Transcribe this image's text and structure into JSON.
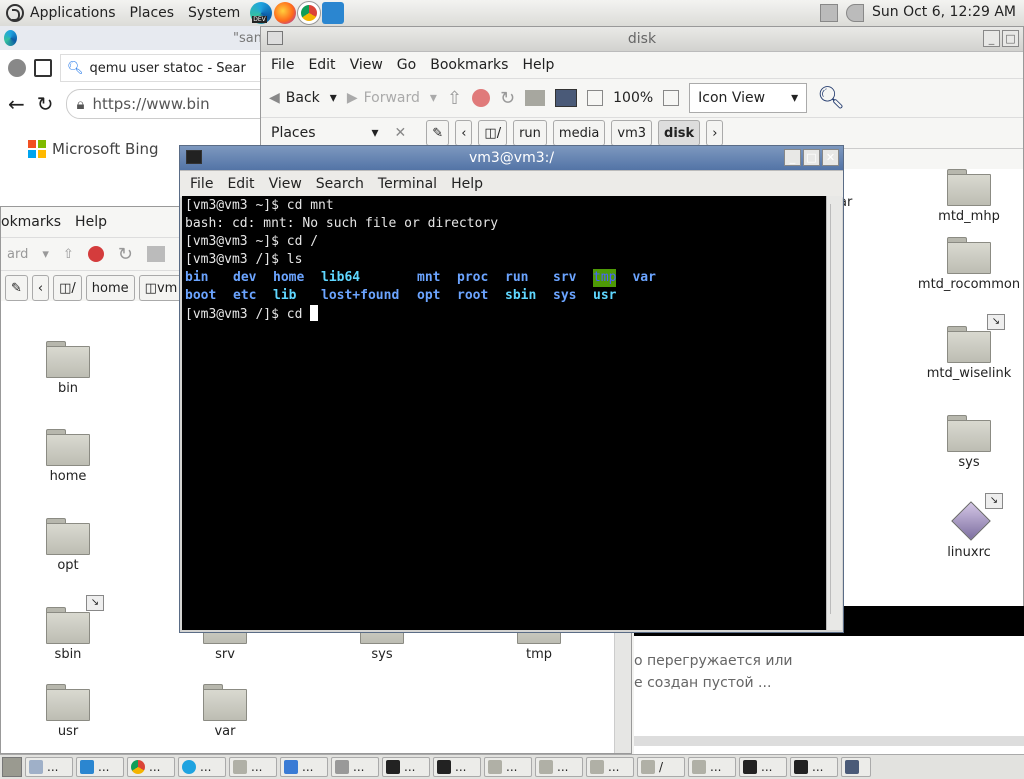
{
  "top_panel": {
    "menus": [
      "Applications",
      "Places",
      "System"
    ],
    "launcher_badge": "DEV",
    "clock": "Sun Oct  6, 12:29 AM",
    "icons": [
      "gnome-foot-icon",
      "edge-dev-icon",
      "firefox-icon",
      "chrome-icon",
      "vscode-icon",
      "network-icon",
      "volume-icon"
    ]
  },
  "browser": {
    "tab_fragment": "\"san",
    "tab_title": "qemu user statoc - Sear",
    "url": "https://www.bin",
    "brand": "Microsoft Bing",
    "brand_colors": [
      "#f25022",
      "#7fba00",
      "#00a4ef",
      "#ffb900"
    ]
  },
  "nautilus_back": {
    "menu": [
      "okmarks",
      "Help"
    ],
    "toolbar_fragment": "ard",
    "path": [
      "home",
      "vm"
    ],
    "items": [
      {
        "label": "bin",
        "link": false
      },
      {
        "label": "home",
        "link": false
      },
      {
        "label": "opt",
        "link": false
      },
      {
        "label": "sbin",
        "link": true
      },
      {
        "label": "srv",
        "link": false
      },
      {
        "label": "sys",
        "link": false
      },
      {
        "label": "tmp",
        "link": false
      },
      {
        "label": "usr",
        "link": false
      },
      {
        "label": "var",
        "link": false
      }
    ]
  },
  "nautilus_disk": {
    "title": "disk",
    "menu": [
      "File",
      "Edit",
      "View",
      "Go",
      "Bookmarks",
      "Help"
    ],
    "back": "Back",
    "forward": "Forward",
    "zoom": "100%",
    "view_mode": "Icon View",
    "places_label": "Places",
    "path": [
      "/",
      "run",
      "media",
      "vm3",
      "disk"
    ],
    "fragment": "ar",
    "items": [
      {
        "label": "mtd_mhp",
        "link": false
      },
      {
        "label": "mtd_rocommon",
        "link": false
      },
      {
        "label": "mtd_wiselink",
        "link": true
      },
      {
        "label": "sys",
        "link": false
      },
      {
        "label": "linuxrc",
        "link": true
      }
    ]
  },
  "lower_right": {
    "line1": "о перегружается или",
    "line2": "е создан пустой ..."
  },
  "terminal": {
    "title": "vm3@vm3:/",
    "menu": [
      "File",
      "Edit",
      "View",
      "Search",
      "Terminal",
      "Help"
    ],
    "lines": [
      "[vm3@vm3 ~]$ cd mnt",
      "bash: cd: mnt: No such file or directory",
      "[vm3@vm3 ~]$ cd /",
      "[vm3@vm3 /]$ ls"
    ],
    "ls_row1": [
      "bin",
      "dev",
      "home",
      "lib64",
      "mnt",
      "proc",
      "run",
      "srv",
      "tmp",
      "var"
    ],
    "ls_row2": [
      "boot",
      "etc",
      "lib",
      "lost+found",
      "opt",
      "root",
      "sbin",
      "sys",
      "usr"
    ],
    "prompt": "[vm3@vm3 /]$ cd "
  },
  "taskbar": {
    "items": [
      "...",
      "...",
      "...",
      "...",
      "...",
      "...",
      "...",
      "...",
      "...",
      "...",
      "...",
      "...",
      "/",
      "...",
      "...",
      "...",
      "..."
    ]
  }
}
